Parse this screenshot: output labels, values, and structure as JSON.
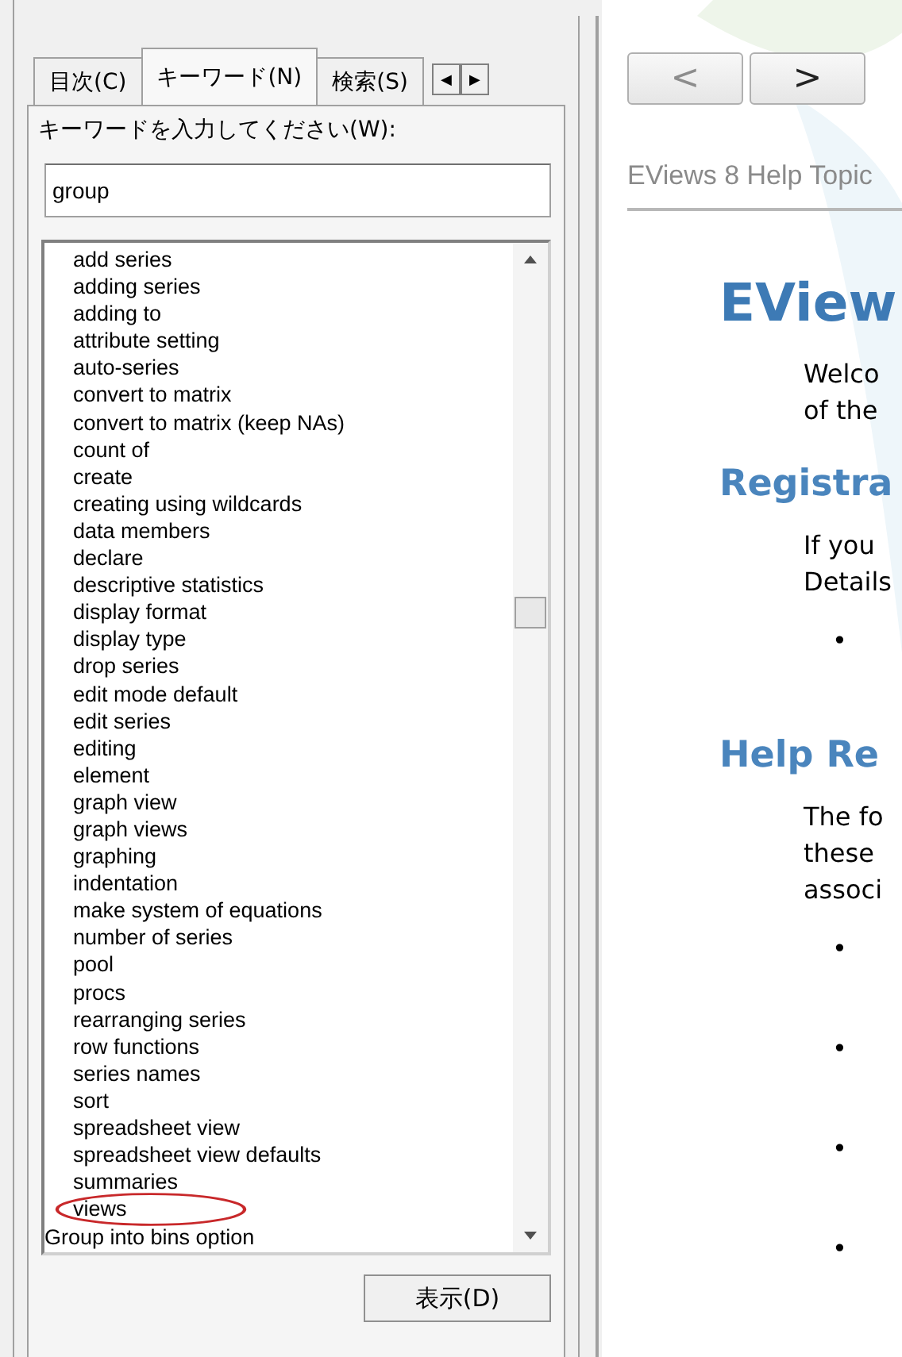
{
  "tabs": [
    {
      "label": "目次(C)",
      "selected": false
    },
    {
      "label": "キーワード(N)",
      "selected": true
    },
    {
      "label": "検索(S)",
      "selected": false
    }
  ],
  "tab_scroll": [
    "◀",
    "▶"
  ],
  "keyword_label": "キーワードを入力してください(W):",
  "keyword_field": {
    "value": "group"
  },
  "keywords": [
    {
      "text": "add series",
      "kind": "sub",
      "circled": false
    },
    {
      "text": "adding series",
      "kind": "sub",
      "circled": false
    },
    {
      "text": "adding to",
      "kind": "sub",
      "circled": false
    },
    {
      "text": "attribute setting",
      "kind": "sub",
      "circled": false
    },
    {
      "text": "auto-series",
      "kind": "sub",
      "circled": false
    },
    {
      "text": "convert to matrix",
      "kind": "sub",
      "circled": false
    },
    {
      "text": "convert to matrix (keep NAs)",
      "kind": "sub",
      "circled": false
    },
    {
      "text": "count of",
      "kind": "sub",
      "circled": false
    },
    {
      "text": "create",
      "kind": "sub",
      "circled": false
    },
    {
      "text": "creating using wildcards",
      "kind": "sub",
      "circled": false
    },
    {
      "text": "data members",
      "kind": "sub",
      "circled": false
    },
    {
      "text": "declare",
      "kind": "sub",
      "circled": false
    },
    {
      "text": "descriptive statistics",
      "kind": "sub",
      "circled": false
    },
    {
      "text": "display format",
      "kind": "sub",
      "circled": false
    },
    {
      "text": "display type",
      "kind": "sub",
      "circled": false
    },
    {
      "text": "drop series",
      "kind": "sub",
      "circled": false
    },
    {
      "text": "edit mode default",
      "kind": "sub",
      "circled": false
    },
    {
      "text": "edit series",
      "kind": "sub",
      "circled": false
    },
    {
      "text": "editing",
      "kind": "sub",
      "circled": false
    },
    {
      "text": "element",
      "kind": "sub",
      "circled": false
    },
    {
      "text": "graph view",
      "kind": "sub",
      "circled": false
    },
    {
      "text": "graph views",
      "kind": "sub",
      "circled": false
    },
    {
      "text": "graphing",
      "kind": "sub",
      "circled": false
    },
    {
      "text": "indentation",
      "kind": "sub",
      "circled": false
    },
    {
      "text": "make system of equations",
      "kind": "sub",
      "circled": false
    },
    {
      "text": "number of series",
      "kind": "sub",
      "circled": false
    },
    {
      "text": "pool",
      "kind": "sub",
      "circled": false
    },
    {
      "text": "procs",
      "kind": "sub",
      "circled": false
    },
    {
      "text": "rearranging series",
      "kind": "sub",
      "circled": false
    },
    {
      "text": "row functions",
      "kind": "sub",
      "circled": false
    },
    {
      "text": "series names",
      "kind": "sub",
      "circled": false
    },
    {
      "text": "sort",
      "kind": "sub",
      "circled": false
    },
    {
      "text": "spreadsheet view",
      "kind": "sub",
      "circled": false
    },
    {
      "text": "spreadsheet view defaults",
      "kind": "sub",
      "circled": false
    },
    {
      "text": "summaries",
      "kind": "sub",
      "circled": false
    },
    {
      "text": "views",
      "kind": "sub",
      "circled": true
    },
    {
      "text": "Group into bins option",
      "kind": "top",
      "circled": false
    }
  ],
  "display_button": "表示(D)",
  "nav": [
    {
      "label": "<",
      "disabled": true
    },
    {
      "label": ">",
      "disabled": false
    }
  ],
  "breadcrumb": "EViews 8 Help Topic",
  "content": [
    {
      "kind": "title",
      "text": "EView"
    },
    {
      "kind": "para",
      "lines": [
        "Welco",
        "of the"
      ]
    },
    {
      "kind": "heading",
      "text": "Registra"
    },
    {
      "kind": "para",
      "lines": [
        "If you",
        "Details"
      ]
    },
    {
      "kind": "bullet",
      "text": "•"
    },
    {
      "kind": "heading",
      "text": "Help Re"
    },
    {
      "kind": "para",
      "lines": [
        "The fo",
        "these",
        "associ"
      ]
    },
    {
      "kind": "bullet",
      "text": "•"
    },
    {
      "kind": "bullet",
      "text": "•"
    },
    {
      "kind": "bullet",
      "text": "•"
    },
    {
      "kind": "bullet",
      "text": "•"
    }
  ]
}
